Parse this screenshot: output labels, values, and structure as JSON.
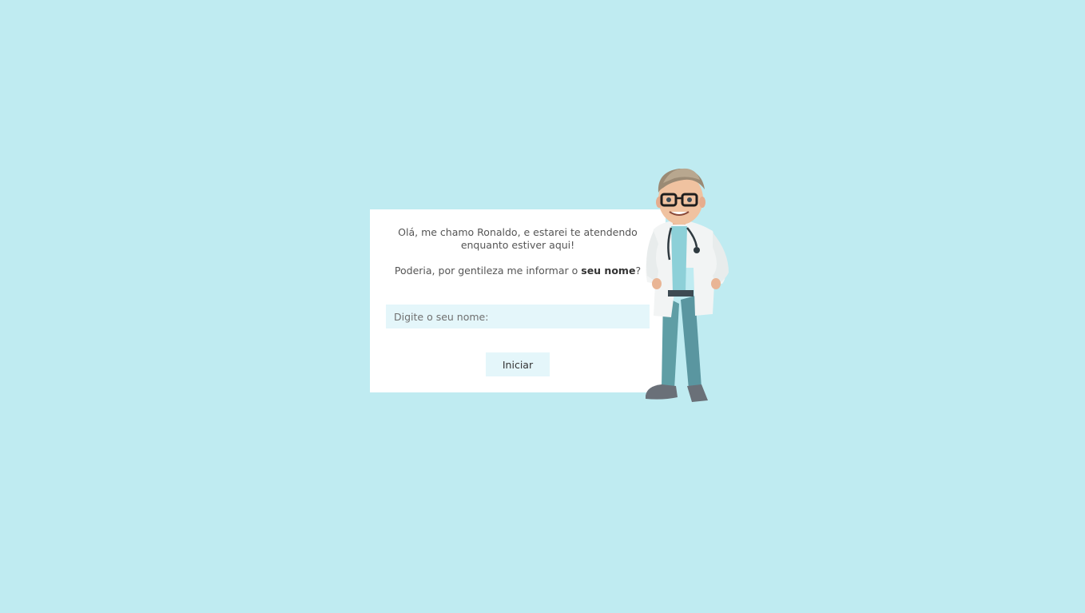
{
  "assistant": {
    "greeting": "Olá, me chamo Ronaldo, e estarei te atendendo enquanto estiver aqui!",
    "question_prefix": "Poderia, por gentileza me informar o ",
    "question_bold": "seu nome",
    "question_suffix": "?"
  },
  "form": {
    "name_placeholder": "Digite o seu nome:",
    "name_value": "",
    "start_label": "Iniciar"
  },
  "icons": {
    "doctor": "doctor-character-illustration"
  },
  "colors": {
    "page_background": "#bfebf1",
    "card_background": "#ffffff",
    "input_background": "#e4f6fa",
    "button_background": "#e4f6fa"
  }
}
